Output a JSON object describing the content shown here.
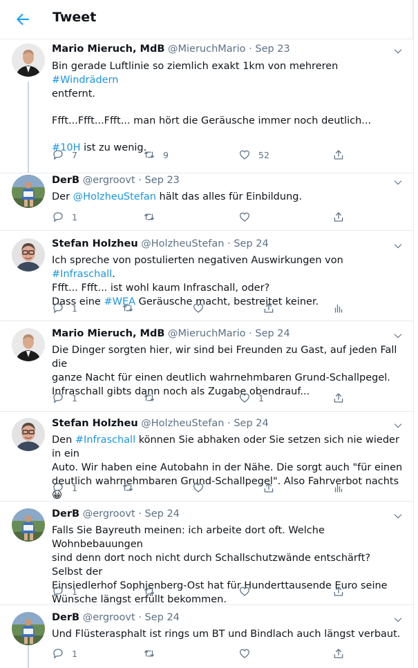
{
  "header": {
    "title": "Tweet"
  },
  "tweets": [
    {
      "name": "Mario Mieruch, MdB",
      "handle": "@MieruchMario",
      "date": "Sep 23",
      "lines": [
        [
          {
            "t": "Bin gerade Luftlinie so ziemlich exakt 1km von mehreren "
          },
          {
            "t": "#Windrädern",
            "link": true
          }
        ],
        [
          {
            "t": "entfernt."
          }
        ],
        [],
        [
          {
            "t": "Ffft...Ffft...Ffft... man hört die Geräusche immer noch deutlich..."
          }
        ],
        [],
        [
          {
            "t": "#10H",
            "link": true
          },
          {
            "t": " ist zu wenig."
          }
        ]
      ],
      "reply_count": "7",
      "retweet_count": "9",
      "like_count": "52"
    },
    {
      "name": "DerB",
      "handle": "@ergroovt",
      "date": "Sep 23",
      "lines": [
        [
          {
            "t": "Der "
          },
          {
            "t": "@HolzheuStefan",
            "link": true
          },
          {
            "t": " hält das alles für Einbildung."
          }
        ]
      ],
      "reply_count": "1",
      "retweet_count": "",
      "like_count": ""
    },
    {
      "name": "Stefan Holzheu",
      "handle": "@HolzheuStefan",
      "date": "Sep 24",
      "lines": [
        [
          {
            "t": "Ich spreche von postulierten negativen Auswirkungen von "
          },
          {
            "t": "#Infraschall",
            "link": true
          },
          {
            "t": "."
          }
        ],
        [
          {
            "t": "Ffft... Ffft... ist wohl kaum Infraschall, oder?"
          }
        ],
        [
          {
            "t": "Dass eine "
          },
          {
            "t": "#WEA",
            "link": true
          },
          {
            "t": " Geräusche macht, bestreitet keiner."
          }
        ]
      ],
      "reply_count": "1",
      "retweet_count": "",
      "like_count": "",
      "analytics": true
    },
    {
      "name": "Mario Mieruch, MdB",
      "handle": "@MieruchMario",
      "date": "Sep 24",
      "lines": [
        [
          {
            "t": "Die Dinger sorgten hier, wir sind bei Freunden zu Gast, auf jeden Fall die"
          }
        ],
        [
          {
            "t": "ganze Nacht für einen deutlich wahrnehmbaren Grund-Schallpegel."
          }
        ],
        [
          {
            "t": "Infraschall gibts dann noch als Zugabe obendrauf..."
          }
        ]
      ],
      "reply_count": "1",
      "retweet_count": "",
      "like_count": "1"
    },
    {
      "name": "Stefan Holzheu",
      "handle": "@HolzheuStefan",
      "date": "Sep 24",
      "lines": [
        [
          {
            "t": "Den "
          },
          {
            "t": "#Infraschall",
            "link": true
          },
          {
            "t": " können Sie abhaken oder Sie setzen sich nie wieder in ein"
          }
        ],
        [
          {
            "t": "Auto. Wir haben eine Autobahn in der Nähe. Die sorgt auch \"für einen"
          }
        ],
        [
          {
            "t": "deutlich wahrnehmbaren Grund-Schallpegel\". Also Fahrverbot nachts 😀"
          }
        ]
      ],
      "reply_count": "1",
      "retweet_count": "",
      "like_count": "",
      "analytics": true
    },
    {
      "name": "DerB",
      "handle": "@ergroovt",
      "date": "Sep 24",
      "lines": [
        [
          {
            "t": "Falls Sie Bayreuth meinen: ich arbeite dort oft. Welche Wohnbebauungen"
          }
        ],
        [
          {
            "t": "sind denn dort noch nicht durch Schallschutzwände entschärft? Selbst der"
          }
        ],
        [
          {
            "t": "Einsiedlerhof Sophienberg-Ost hat für Hunderttausende Euro seine"
          }
        ],
        [
          {
            "t": "Wünsche längst erfüllt bekommen."
          }
        ]
      ],
      "reply_count": "1",
      "retweet_count": "",
      "like_count": ""
    },
    {
      "name": "DerB",
      "handle": "@ergroovt",
      "date": "Sep 24",
      "lines": [
        [
          {
            "t": "Und Flüsterasphalt ist rings um BT und Bindlach auch längst verbaut."
          }
        ]
      ],
      "reply_count": "1",
      "retweet_count": "",
      "like_count": ""
    }
  ]
}
